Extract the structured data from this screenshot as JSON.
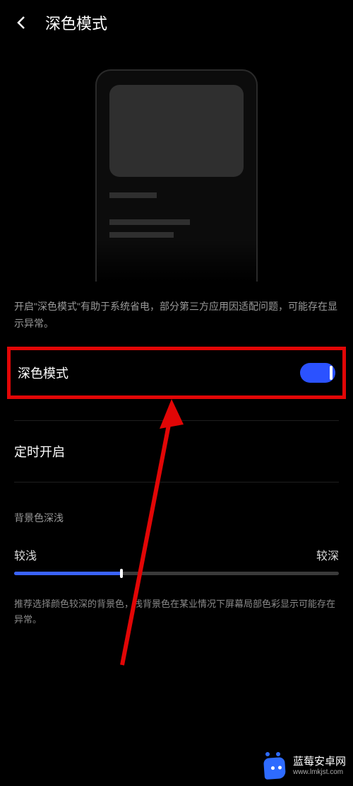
{
  "header": {
    "title": "深色模式"
  },
  "description": "开启\"深色模式\"有助于系统省电，部分第三方应用因适配问题，可能存在显示异常。",
  "dark_mode_toggle": {
    "label": "深色模式",
    "enabled": true
  },
  "schedule": {
    "label": "定时开启"
  },
  "bg_depth": {
    "heading": "背景色深浅",
    "left_label": "较浅",
    "right_label": "较深",
    "value_percent": 33,
    "description": "推荐选择颜色较深的背景色，浅背景色在某业情况下屏幕局部色彩显示可能存在异常。"
  },
  "watermark": {
    "name": "蓝莓安卓网",
    "url": "www.lmkjst.com"
  }
}
